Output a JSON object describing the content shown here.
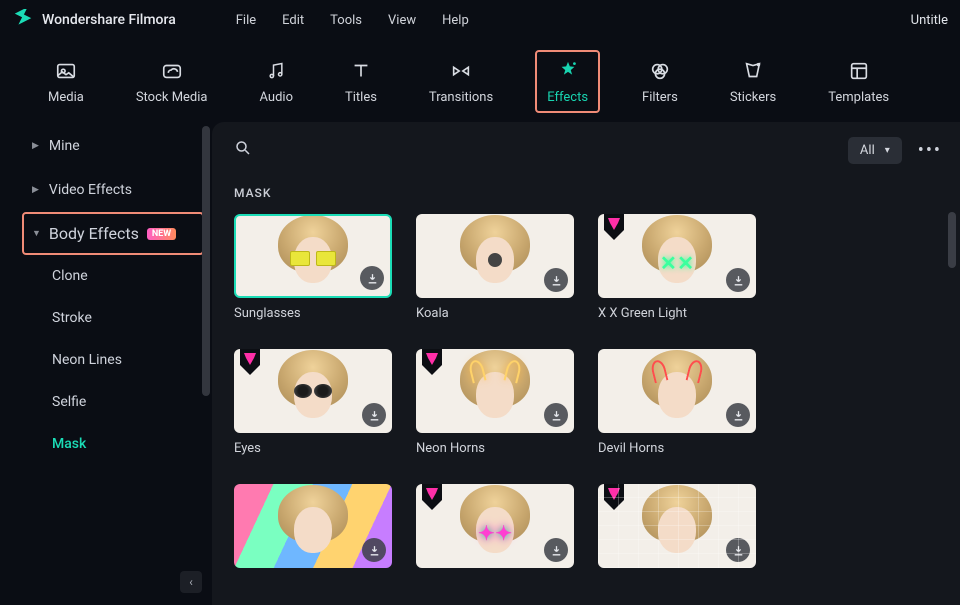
{
  "app": {
    "name": "Wondershare Filmora",
    "docTitle": "Untitle"
  },
  "menu": [
    "File",
    "Edit",
    "Tools",
    "View",
    "Help"
  ],
  "tabs": [
    {
      "id": "media",
      "label": "Media"
    },
    {
      "id": "stock-media",
      "label": "Stock Media"
    },
    {
      "id": "audio",
      "label": "Audio"
    },
    {
      "id": "titles",
      "label": "Titles"
    },
    {
      "id": "transitions",
      "label": "Transitions"
    },
    {
      "id": "effects",
      "label": "Effects",
      "active": true
    },
    {
      "id": "filters",
      "label": "Filters"
    },
    {
      "id": "stickers",
      "label": "Stickers"
    },
    {
      "id": "templates",
      "label": "Templates"
    }
  ],
  "sidebar": {
    "mine": "Mine",
    "videoEffects": "Video Effects",
    "bodyEffects": {
      "label": "Body Effects",
      "badge": "NEW"
    },
    "subs": [
      "Clone",
      "Stroke",
      "Neon Lines",
      "Selfie",
      "Mask"
    ],
    "activeSub": "Mask"
  },
  "main": {
    "filter": "All",
    "sectionTitle": "MASK",
    "cards": [
      {
        "label": "Sunglasses",
        "selected": true,
        "gem": false,
        "variant": "sunglasses"
      },
      {
        "label": "Koala",
        "gem": false,
        "variant": "koala"
      },
      {
        "label": "X X Green Light",
        "gem": true,
        "variant": "xx"
      },
      {
        "label": "Eyes",
        "gem": true,
        "variant": "eyes"
      },
      {
        "label": "Neon Horns",
        "gem": true,
        "variant": "neonhorns"
      },
      {
        "label": "Devil Horns",
        "gem": false,
        "variant": "devilhorns"
      },
      {
        "label": "",
        "gem": false,
        "variant": "rainbow"
      },
      {
        "label": "",
        "gem": true,
        "variant": "pinkglow"
      },
      {
        "label": "",
        "gem": true,
        "variant": "tech"
      }
    ]
  }
}
